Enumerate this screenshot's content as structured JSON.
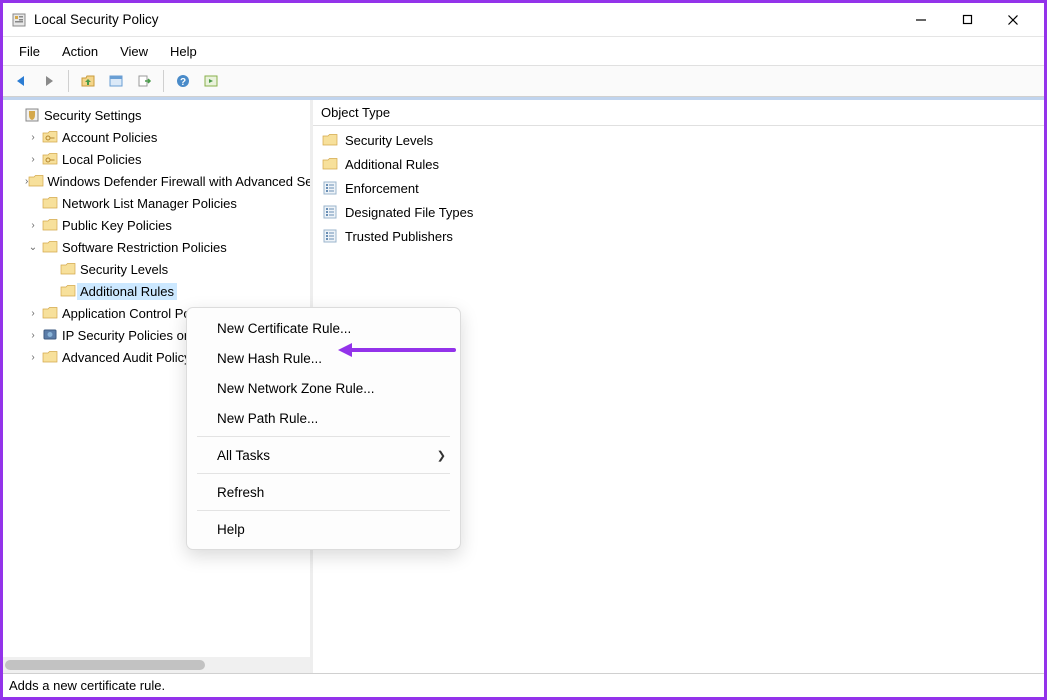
{
  "window": {
    "title": "Local Security Policy"
  },
  "menubar": [
    "File",
    "Action",
    "View",
    "Help"
  ],
  "toolbar_icons": [
    "back",
    "forward",
    "up-folder",
    "properties",
    "export",
    "help",
    "show-all"
  ],
  "tree": {
    "root": {
      "label": "Security Settings",
      "icon": "security-root"
    },
    "items": [
      {
        "label": "Account Policies",
        "icon": "folder-key",
        "expander": "›",
        "depth": 1
      },
      {
        "label": "Local Policies",
        "icon": "folder-key",
        "expander": "›",
        "depth": 1
      },
      {
        "label": "Windows Defender Firewall with Advanced Security",
        "icon": "folder",
        "expander": "›",
        "depth": 1
      },
      {
        "label": "Network List Manager Policies",
        "icon": "folder",
        "expander": "",
        "depth": 1
      },
      {
        "label": "Public Key Policies",
        "icon": "folder",
        "expander": "›",
        "depth": 1
      },
      {
        "label": "Software Restriction Policies",
        "icon": "folder",
        "expander": "⌄",
        "depth": 1
      },
      {
        "label": "Security Levels",
        "icon": "folder",
        "expander": "",
        "depth": 2
      },
      {
        "label": "Additional Rules",
        "icon": "folder",
        "expander": "",
        "depth": 2,
        "selected": true
      },
      {
        "label": "Application Control Policies",
        "icon": "folder",
        "expander": "›",
        "depth": 1
      },
      {
        "label": "IP Security Policies on Local Computer",
        "icon": "ip-policy",
        "expander": "›",
        "depth": 1
      },
      {
        "label": "Advanced Audit Policy Configuration",
        "icon": "folder",
        "expander": "›",
        "depth": 1
      }
    ]
  },
  "list": {
    "header": "Object Type",
    "items": [
      {
        "label": "Security Levels",
        "icon": "folder"
      },
      {
        "label": "Additional Rules",
        "icon": "folder"
      },
      {
        "label": "Enforcement",
        "icon": "policy-item"
      },
      {
        "label": "Designated File Types",
        "icon": "policy-item"
      },
      {
        "label": "Trusted Publishers",
        "icon": "policy-item"
      }
    ]
  },
  "context_menu": {
    "items": [
      {
        "label": "New Certificate Rule...",
        "type": "item"
      },
      {
        "label": "New Hash Rule...",
        "type": "item"
      },
      {
        "label": "New Network Zone Rule...",
        "type": "item"
      },
      {
        "label": "New Path Rule...",
        "type": "item"
      },
      {
        "type": "sep"
      },
      {
        "label": "All Tasks",
        "type": "submenu"
      },
      {
        "type": "sep"
      },
      {
        "label": "Refresh",
        "type": "item"
      },
      {
        "type": "sep"
      },
      {
        "label": "Help",
        "type": "item"
      }
    ]
  },
  "statusbar": {
    "text": "Adds a new certificate rule."
  },
  "colors": {
    "accent": "#9333ea",
    "selection": "#cce8ff"
  }
}
